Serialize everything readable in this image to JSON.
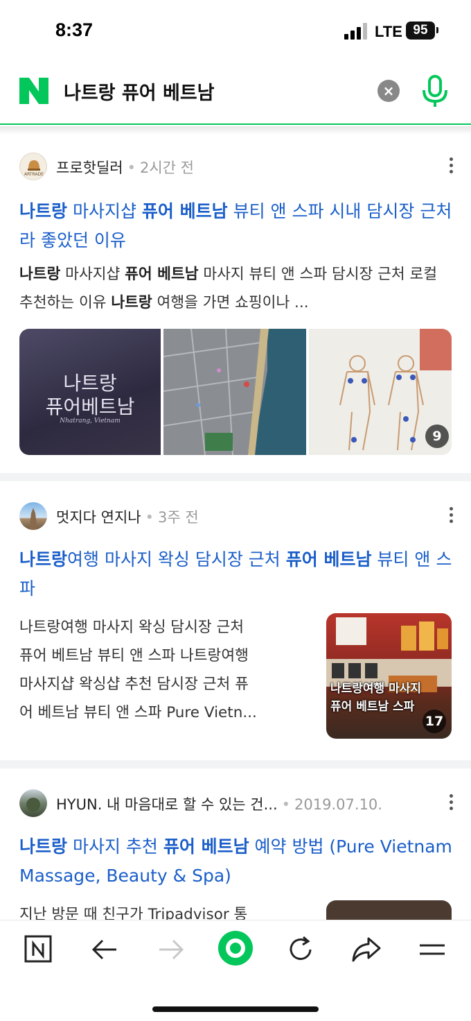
{
  "status": {
    "time": "8:37",
    "network": "LTE",
    "battery": "95"
  },
  "search": {
    "query": "나트랑 퓨어 베트남"
  },
  "results": [
    {
      "author": "프로핫딜러",
      "time": "2시간 전",
      "avatar_text": "ARTRADE",
      "title_parts": [
        {
          "text": "나트랑",
          "bold": true
        },
        {
          "text": " 마사지샵 ",
          "bold": false
        },
        {
          "text": "퓨어 베트남",
          "bold": true
        },
        {
          "text": " 뷰티 앤 스파 시내 담시장 근처라 좋았던 이유",
          "bold": false
        }
      ],
      "desc_parts": [
        {
          "text": "나트랑",
          "bold": true
        },
        {
          "text": " 마사지샵 ",
          "bold": false
        },
        {
          "text": "퓨어 베트남",
          "bold": true
        },
        {
          "text": " 마사지 뷰티 앤 스파 담시장 근처 로컬 추천하는 이유 ",
          "bold": false
        },
        {
          "text": "나트랑",
          "bold": true
        },
        {
          "text": " 여행을 가면 쇼핑이나 ...",
          "bold": false
        }
      ],
      "thumb1_line1": "나트랑",
      "thumb1_line2": "퓨어베트남",
      "thumb1_caption": "Nhatrang, Vietnam",
      "image_count": "9"
    },
    {
      "author": "멋지다 연지나",
      "time": "3주 전",
      "title_parts": [
        {
          "text": "나트랑",
          "bold": true
        },
        {
          "text": "여행 마사지 왁싱 담시장 근처 ",
          "bold": false
        },
        {
          "text": "퓨어 베트남",
          "bold": true
        },
        {
          "text": " 뷰티 앤 스파",
          "bold": false
        }
      ],
      "desc_lines": [
        "나트랑여행 마사지 왁싱 담시장 근처",
        "퓨어 베트남 뷰티 앤 스파 나트랑여행",
        "마사지샵 왁싱샵 추천 담시장 근처 퓨",
        "어 베트남 뷰티 앤 스파 Pure Vietn..."
      ],
      "thumb_line1": "나트랑여행 마사지",
      "thumb_line2": "퓨어 베트남 스파",
      "image_count": "17"
    },
    {
      "author": "HYUN. 내 마음대로 할 수 있는 건...",
      "time": "2019.07.10.",
      "title_parts": [
        {
          "text": "나트랑",
          "bold": true
        },
        {
          "text": " 마사지 추천 ",
          "bold": false
        },
        {
          "text": "퓨어 베트남",
          "bold": true
        },
        {
          "text": " 예약 방법 (Pure Vietnam Massage, Beauty & Spa)",
          "bold": false
        }
      ],
      "desc_line": "지난 방문 때 친구가 Tripadvisor 통"
    }
  ],
  "bottom_nav": {
    "items": [
      "naver-home",
      "back",
      "forward",
      "green-dot",
      "refresh",
      "share",
      "menu"
    ]
  },
  "colors": {
    "brand_green": "#03c75a",
    "link_blue": "#1a5ec9"
  }
}
